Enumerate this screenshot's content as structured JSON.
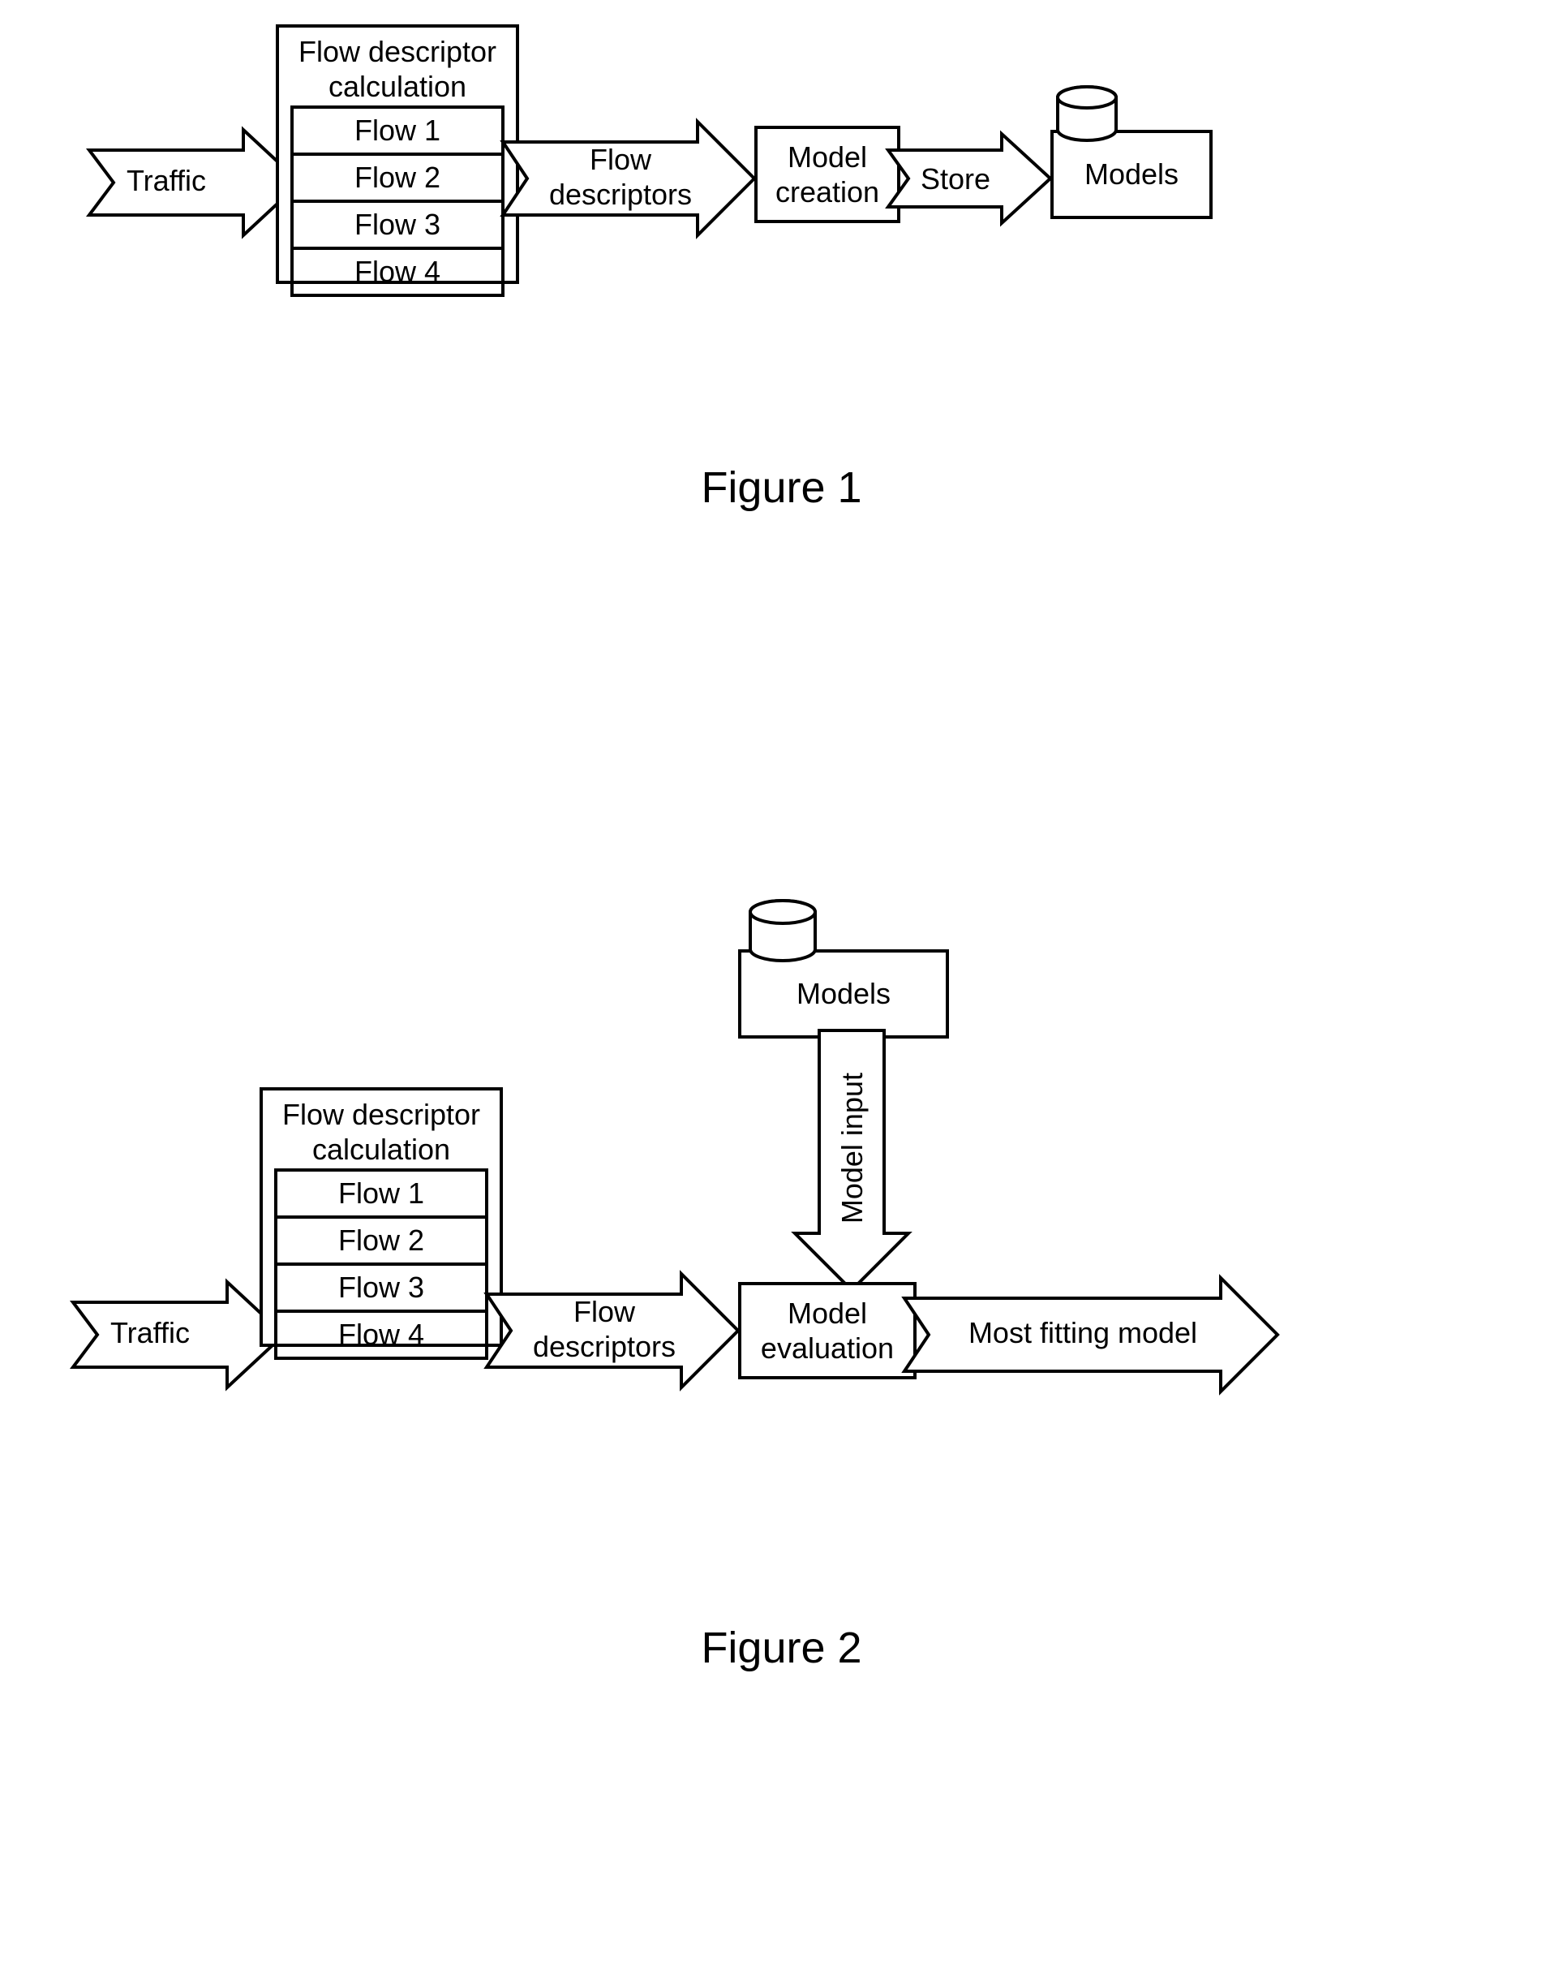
{
  "figure1": {
    "traffic_label": "Traffic",
    "flow_header_l1": "Flow descriptor",
    "flow_header_l2": "calculation",
    "flow1": "Flow 1",
    "flow2": "Flow 2",
    "flow3": "Flow 3",
    "flow4": "Flow 4",
    "flow_desc_l1": "Flow",
    "flow_desc_l2": "descriptors",
    "model_creation_l1": "Model",
    "model_creation_l2": "creation",
    "store_label": "Store",
    "models_label": "Models",
    "caption": "Figure 1"
  },
  "figure2": {
    "traffic_label": "Traffic",
    "flow_header_l1": "Flow descriptor",
    "flow_header_l2": "calculation",
    "flow1": "Flow 1",
    "flow2": "Flow 2",
    "flow3": "Flow 3",
    "flow4": "Flow 4",
    "flow_desc_l1": "Flow",
    "flow_desc_l2": "descriptors",
    "models_label": "Models",
    "model_input_label": "Model input",
    "model_eval_l1": "Model",
    "model_eval_l2": "evaluation",
    "most_fitting_label": "Most fitting model",
    "caption": "Figure 2"
  }
}
